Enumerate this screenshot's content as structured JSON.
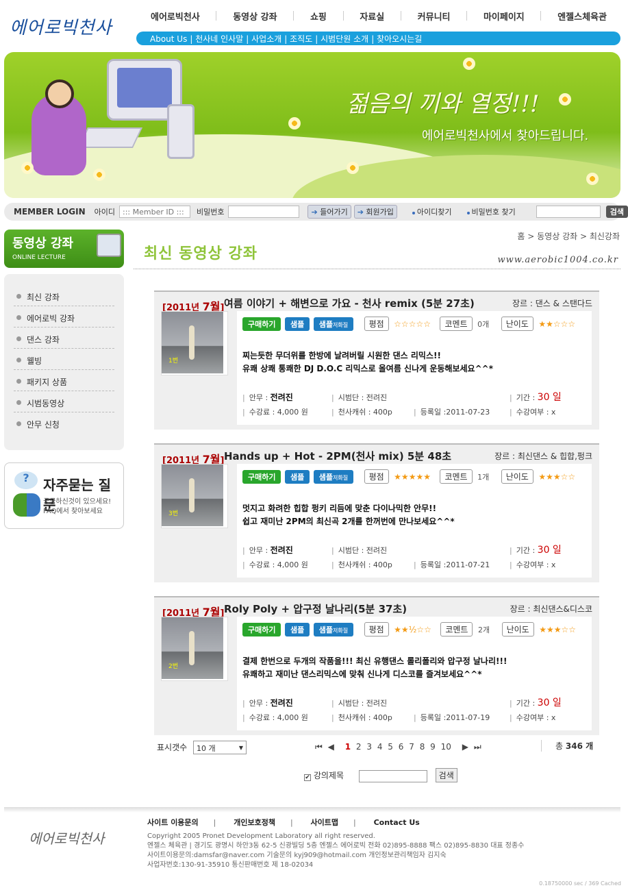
{
  "logo": "에어로빅천사",
  "gnb": [
    "에어로빅천사",
    "동영상 강좌",
    "쇼핑",
    "자료실",
    "커뮤니티",
    "마이페이지",
    "엔젤스체육관"
  ],
  "subnav": [
    "About Us",
    "천사네 인사말",
    "사업소개",
    "조직도",
    "시범단원 소개",
    "찾아오시는길"
  ],
  "banner": {
    "title": "젊음의 끼와 열정!!!",
    "subtitle": "에어로빅천사에서 찾아드립니다."
  },
  "login": {
    "label": "MEMBER LOGIN",
    "id_label": "아이디",
    "id_placeholder": "::: Member ID :::",
    "pw_label": "비밀번호",
    "login_btn": "들어가기",
    "join_btn": "회원가입",
    "find_id": "아이디찾기",
    "find_pw": "비밀번호 찾기",
    "search_btn": "검색"
  },
  "lnb": {
    "title": "동영상 강좌",
    "subtitle": "ONLINE LECTURE",
    "items": [
      "최신 강좌",
      "에어로빅 강좌",
      "댄스 강좌",
      "웰빙",
      "패키지 상품",
      "시범동영상",
      "안무 신청"
    ]
  },
  "faq": {
    "title": "자주묻는 질문",
    "line1": "궁금하신것이 있으세요!",
    "line2": "FAQ에서 찾아보세요"
  },
  "breadcrumb": "홈 > 동영상 강좌 > 최신강좌",
  "page_title": "최신 동영상 강좌",
  "site_url": "www.aerobic1004.co.kr",
  "labels": {
    "buy": "구매하기",
    "sample": "샘플",
    "sample_low": "샘플",
    "low": "저화질",
    "rating": "평점",
    "comment": "코멘트",
    "difficulty": "난이도",
    "choreo": "안무 :",
    "demo": "시범단 :",
    "period": "기간 :",
    "fee": "수강료 :",
    "angel_cash": "천사캐쉬 :",
    "reg_date": "등록일 :",
    "status": "수강여부 :",
    "genre": "장르 :"
  },
  "lectures": [
    {
      "year": "[2011년",
      "month": "7월",
      "close": "]",
      "title": "여름 이야기 + 해변으로 가요 - 천사 remix (5분 27초)",
      "genre": "댄스 & 스탠다드",
      "rating_stars": "☆☆☆☆☆",
      "comment_count": "0개",
      "difficulty_stars": "★★☆☆☆",
      "desc1": "찌는듯한 무더위를 한방에 날려버릴 시원한 댄스 리믹스!!",
      "desc2": "유쾌 상쾌 통쾌한 DJ D.O.C 리믹스로 올여름 신나게 운동해보세요^^*",
      "choreographer": "전려진",
      "demo": "전려진",
      "period": "30 일",
      "fee": "4,000 원",
      "cash": "400p",
      "date": "2011-07-23",
      "status": "x",
      "thumb_num": "1번"
    },
    {
      "year": "[2011년",
      "month": "7월",
      "close": "]",
      "title": "Hands up + Hot - 2PM(천사 mix) 5분 48초",
      "genre": "최신댄스 & 힙합,펑크",
      "rating_stars": "★★★★★",
      "comment_count": "1개",
      "difficulty_stars": "★★★☆☆",
      "desc1": "멋지고 화려한 힙합 펑키 리듬에 맞춘 다이나믹한 안무!!",
      "desc2": "쉽고 재미난 2PM의 최신곡 2개를 한꺼번에 만나보세요^^*",
      "choreographer": "전려진",
      "demo": "전려진",
      "period": "30 일",
      "fee": "4,000 원",
      "cash": "400p",
      "date": "2011-07-21",
      "status": "x",
      "thumb_num": "3번"
    },
    {
      "year": "[2011년",
      "month": "7월",
      "close": "]",
      "title": "Roly Poly + 압구정 날나리(5분 37초)",
      "genre": "최신댄스&디스코",
      "rating_stars": "★★½☆☆",
      "comment_count": "2개",
      "difficulty_stars": "★★★☆☆",
      "desc1": "결제 한번으로 두개의 작품을!!! 최신 유행댄스 롤리폴리와 압구정 날나리!!!",
      "desc2": "유쾌하고 재미난 댄스리믹스에 맞춰 신나게 디스코를 즐겨보세요^^*",
      "choreographer": "전려진",
      "demo": "전려진",
      "period": "30 일",
      "fee": "4,000 원",
      "cash": "400p",
      "date": "2011-07-19",
      "status": "x",
      "thumb_num": "2번"
    }
  ],
  "paging": {
    "per_label": "표시갯수",
    "per_value": "10 개",
    "first": "⏮",
    "prev": "◀",
    "next": "▶",
    "last": "⏭",
    "pages": [
      "1",
      "2",
      "3",
      "4",
      "5",
      "6",
      "7",
      "8",
      "9",
      "10"
    ],
    "current": "1",
    "total_prefix": "총",
    "total": "346 개"
  },
  "search": {
    "check_mark": "✔",
    "label": "강의제목",
    "button": "검색"
  },
  "footer": {
    "logo": "에어로빅천사",
    "links": [
      "사이트 이용문의",
      "개인보호정책",
      "사이트맵",
      "Contact Us"
    ],
    "copyright": "Copyright  2005  Pronet Development Laboratory all right reserved.",
    "line1": "엔젤스 체육관 | 경기도 광명시 하안3동 62-5 신광빌딩 5층 엔젤스 에어로빅 전화  02)895-8888 팩스 02)895-8830 대표 정종수",
    "line2": "사이트이용문의:damsfar@naver.com 기술문의 kyj909@hotmail.com 개인정보관리책임자 김지숙",
    "line3": "사업자번호:130-91-35910 통신판매번호 제 18-02034",
    "timing": "0.18750000 sec /   369 Cached"
  },
  "colors": {
    "accent_blue": "#1aa0dd",
    "green": "#8fc43a",
    "red": "#c00000",
    "star": "#f39a14"
  }
}
